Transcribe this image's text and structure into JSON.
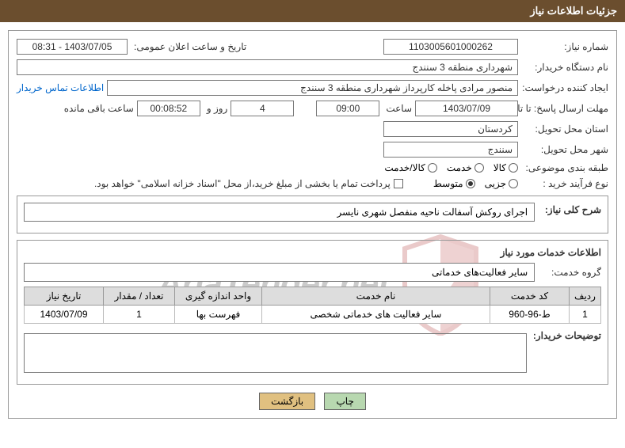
{
  "header": {
    "title": "جزئیات اطلاعات نیاز"
  },
  "fields": {
    "need_no_label": "شماره نیاز:",
    "need_no": "1103005601000262",
    "announce_label": "تاریخ و ساعت اعلان عمومی:",
    "announce_value": "1403/07/05 - 08:31",
    "buyer_org_label": "نام دستگاه خریدار:",
    "buyer_org": "شهرداری منطقه 3 سنندج",
    "requester_label": "ایجاد کننده درخواست:",
    "requester": "منصور مرادی پاخله کارپرداز شهرداری منطقه 3 سنندج",
    "contact_link": "اطلاعات تماس خریدار",
    "deadline_label": "مهلت ارسال پاسخ: تا تاریخ:",
    "deadline_date": "1403/07/09",
    "time_label": "ساعت",
    "deadline_time": "09:00",
    "days_value": "4",
    "days_suffix": "روز و",
    "countdown": "00:08:52",
    "remaining_label": "ساعت باقی مانده",
    "province_label": "استان محل تحویل:",
    "province": "کردستان",
    "city_label": "شهر محل تحویل:",
    "city": "سنندج",
    "category_label": "طبقه بندی موضوعی:",
    "purchase_type_label": "نوع فرآیند خرید :",
    "payment_note": "پرداخت تمام یا بخشی از مبلغ خرید،از محل \"اسناد خزانه اسلامی\" خواهد بود."
  },
  "radios": {
    "cat": [
      {
        "label": "کالا",
        "checked": false
      },
      {
        "label": "خدمت",
        "checked": false
      },
      {
        "label": "کالا/خدمت",
        "checked": false
      }
    ],
    "ptype": [
      {
        "label": "جزیی",
        "checked": false
      },
      {
        "label": "متوسط",
        "checked": true
      }
    ]
  },
  "desc": {
    "title": "شرح کلی نیاز:",
    "text": "اجرای روکش آسفالت ناحیه منفصل شهری نایسر"
  },
  "services": {
    "heading": "اطلاعات خدمات مورد نیاز",
    "group_label": "گروه خدمت:",
    "group_value": "سایر فعالیت‌های خدماتی"
  },
  "table": {
    "headers": [
      "ردیف",
      "کد خدمت",
      "نام خدمت",
      "واحد اندازه گیری",
      "تعداد / مقدار",
      "تاریخ نیاز"
    ],
    "rows": [
      {
        "c0": "1",
        "c1": "ط-96-960",
        "c2": "سایر فعالیت های خدماتی شخصی",
        "c3": "فهرست بها",
        "c4": "1",
        "c5": "1403/07/09"
      }
    ]
  },
  "notes_label": "توضیحات خریدار:",
  "buttons": {
    "print": "چاپ",
    "back": "بازگشت"
  },
  "watermark": "AriaTender.net"
}
